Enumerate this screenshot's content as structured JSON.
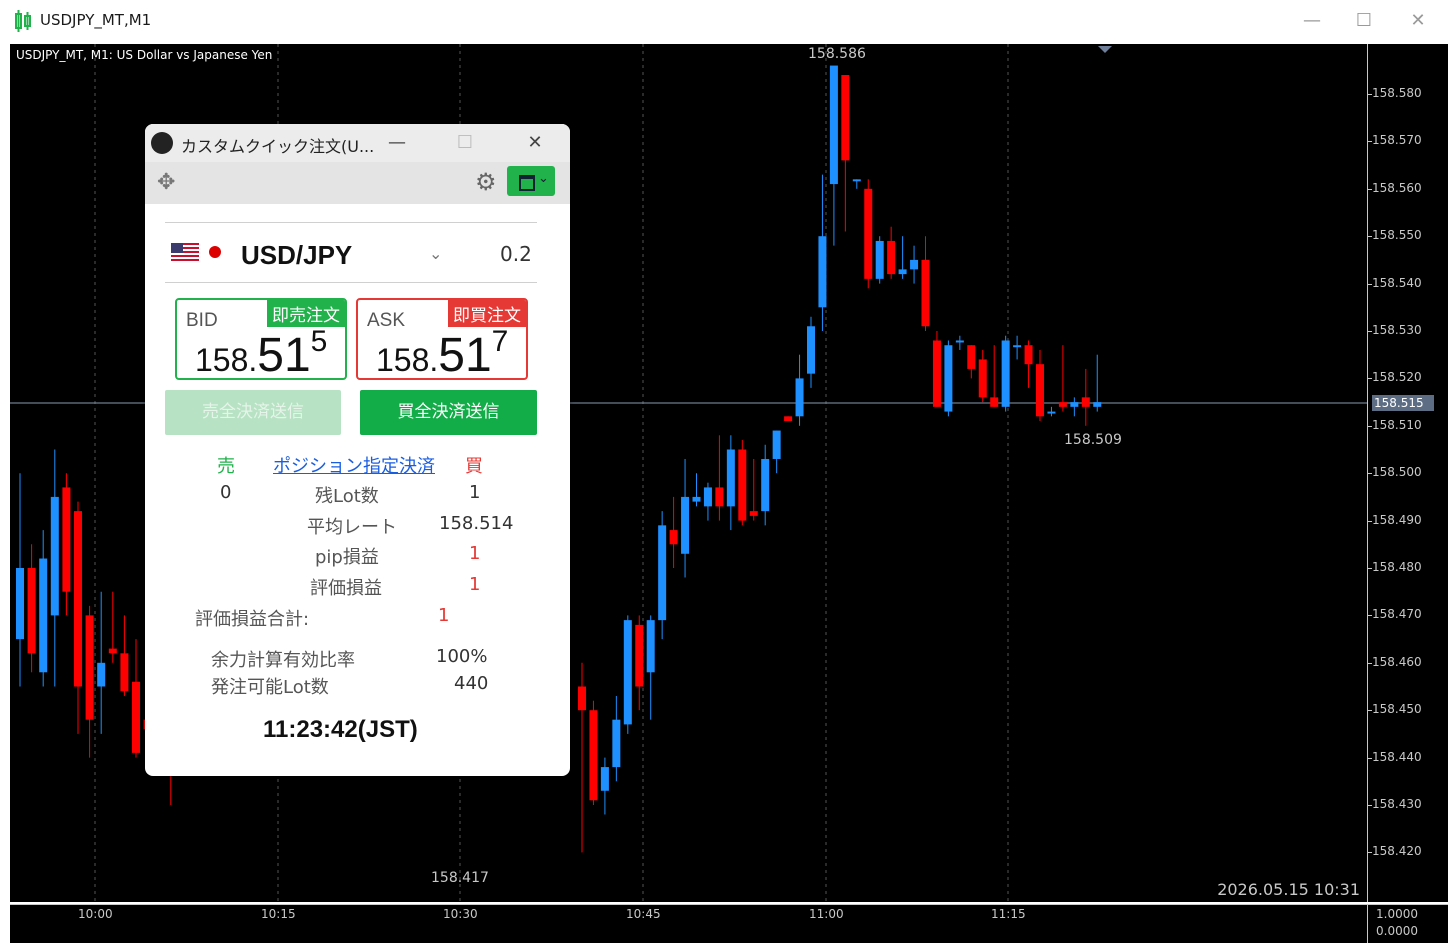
{
  "window": {
    "title": "USDJPY_MT,M1",
    "minimize": "—",
    "maximize": "☐",
    "close": "✕"
  },
  "chart": {
    "header": "USDJPY_MT, M1:  US Dollar vs Japanese Yen",
    "high_label": "158.586",
    "low_label": "158.417",
    "last_label": "158.509",
    "current_price": "158.515",
    "datetime": "2026.05.15 10:31",
    "price_ticks": [
      "158.580",
      "158.570",
      "158.560",
      "158.550",
      "158.540",
      "158.530",
      "158.520",
      "158.510",
      "158.500",
      "158.490",
      "158.480",
      "158.470",
      "158.460",
      "158.450",
      "158.440",
      "158.430",
      "158.420"
    ],
    "time_ticks": [
      "10:00",
      "10:15",
      "10:30",
      "10:45",
      "11:00",
      "11:15"
    ],
    "indicator_ticks": [
      "1.0000",
      "0.0000"
    ],
    "colors": {
      "bull": "#1e90ff",
      "bear": "#ff0000",
      "background": "#000000"
    }
  },
  "chart_data": {
    "type": "candlestick",
    "candles": [
      {
        "o": 158.47,
        "h": 158.497,
        "l": 158.455,
        "c": 158.49,
        "bull": true
      },
      {
        "o": 158.49,
        "h": 158.485,
        "l": 158.465,
        "c": 158.47,
        "bull": false
      },
      {
        "o": 158.464,
        "h": 158.505,
        "l": 158.46,
        "c": 158.49,
        "bull": true
      },
      {
        "o": 158.488,
        "h": 158.482,
        "l": 158.478,
        "c": 158.5,
        "bull": true
      },
      {
        "o": 158.492,
        "h": 158.495,
        "l": 158.44,
        "c": 158.47,
        "bull": false
      },
      {
        "o": 158.468,
        "h": 158.475,
        "l": 158.445,
        "c": 158.45,
        "bull": false
      },
      {
        "o": 158.447,
        "h": 158.475,
        "l": 158.445,
        "c": 158.46,
        "bull": true
      },
      {
        "o": 158.46,
        "h": 158.48,
        "l": 158.455,
        "c": 158.463,
        "bull": true
      }
    ]
  },
  "panel": {
    "title": "カスタムクイック注文(U...",
    "symbol": "USD/JPY",
    "spread": "0.2",
    "bid": {
      "label": "BID",
      "tag": "即売注文",
      "p1": "158.",
      "p2": "51",
      "p3": "5"
    },
    "ask": {
      "label": "ASK",
      "tag": "即買注文",
      "p1": "158.",
      "p2": "51",
      "p3": "7"
    },
    "sell_close_btn": "売全決済送信",
    "buy_close_btn": "買全決済送信",
    "sell_header": "売",
    "buy_header": "買",
    "position_link": "ポジション指定決済",
    "rows": {
      "lots": {
        "label": "残Lot数",
        "sell": "0",
        "buy": "1"
      },
      "avg_rate": {
        "label": "平均レート",
        "buy": "158.514"
      },
      "pip_pl": {
        "label": "pip損益",
        "buy": "1"
      },
      "eval_pl": {
        "label": "評価損益",
        "buy": "1"
      }
    },
    "total_pl": {
      "label": "評価損益合計:",
      "value": "1"
    },
    "margin_ratio": {
      "label": "余力計算有効比率",
      "value": "100%"
    },
    "orderable_lots": {
      "label": "発注可能Lot数",
      "value": "440"
    },
    "clock": "11:23:42(JST)"
  }
}
